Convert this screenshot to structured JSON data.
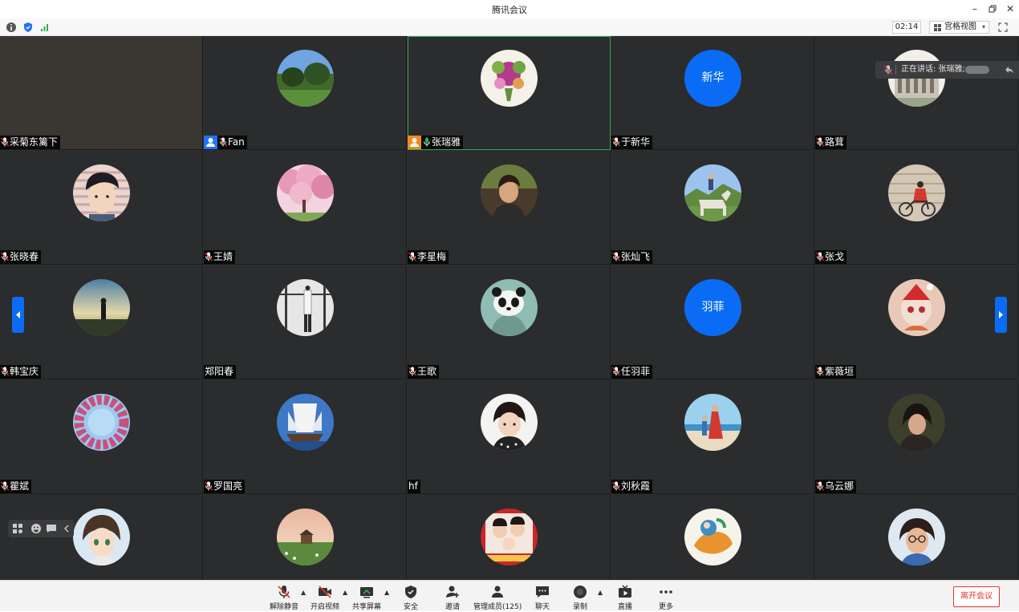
{
  "window": {
    "title": "腾讯会议"
  },
  "top_toolbar": {
    "timer": "02:14",
    "view_label": "宫格视图"
  },
  "speaking_banner": {
    "text": "正在讲话: 张瑞雅;"
  },
  "colors": {
    "accent": "#0a6cf5",
    "stage_bg": "#2d2e30",
    "active_border": "#2fa84f",
    "leave": "#e3362f"
  },
  "participants": [
    {
      "name": "采菊东篱下",
      "avatar": "photo-dark"
    },
    {
      "name": "Fan",
      "avatar": "photo-trees",
      "badge": "host-blue"
    },
    {
      "name": "张瑞雅",
      "avatar": "photo-flowers",
      "badge": "host-orange",
      "speaking": true
    },
    {
      "name": "于新华",
      "avatar_text": "新华"
    },
    {
      "name": "路茸",
      "avatar": "photo-building"
    },
    {
      "name": "张晓春",
      "avatar": "photo-person"
    },
    {
      "name": "王婧",
      "avatar": "photo-blossom"
    },
    {
      "name": "李星梅",
      "avatar": "photo-woman"
    },
    {
      "name": "张灿飞",
      "avatar": "photo-horse"
    },
    {
      "name": "张戈",
      "avatar": "photo-bike"
    },
    {
      "name": "韩宝庆",
      "avatar": "photo-silhouette"
    },
    {
      "name": "郑阳春",
      "avatar": "photo-window",
      "no_mic": true
    },
    {
      "name": "王歌",
      "avatar": "photo-panda"
    },
    {
      "name": "任羽菲",
      "avatar_text": "羽菲"
    },
    {
      "name": "紫薇垣",
      "avatar": "photo-cartoon"
    },
    {
      "name": "瞿斌",
      "avatar": "photo-wreath"
    },
    {
      "name": "罗国亮",
      "avatar": "photo-ship"
    },
    {
      "name": "hf",
      "avatar": "photo-girl",
      "no_mic": true
    },
    {
      "name": "刘秋霞",
      "avatar": "photo-beach"
    },
    {
      "name": "乌云娜",
      "avatar": "photo-lady"
    },
    {
      "name": "",
      "avatar": "photo-anime"
    },
    {
      "name": "",
      "avatar": "photo-meadow"
    },
    {
      "name": "",
      "avatar": "photo-family"
    },
    {
      "name": "",
      "avatar": "photo-painting"
    },
    {
      "name": "",
      "avatar": "photo-glasses"
    }
  ],
  "controls": {
    "unmute": "解除静音",
    "start_video": "开启视频",
    "share_screen": "共享屏幕",
    "security": "安全",
    "invite": "邀请",
    "manage_members": "管理成员(125)",
    "chat": "聊天",
    "record": "录制",
    "live": "直播",
    "more": "更多",
    "leave": "离开会议"
  }
}
